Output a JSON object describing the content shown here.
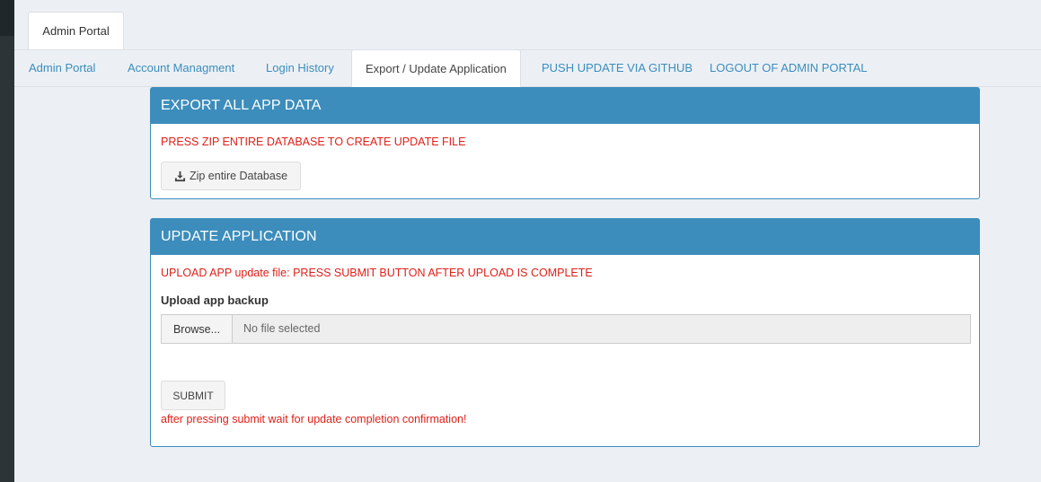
{
  "top_tab": {
    "label": "Admin Portal"
  },
  "nav": {
    "tabs": [
      {
        "label": "Admin Portal"
      },
      {
        "label": "Account Managment"
      },
      {
        "label": "Login History"
      },
      {
        "label": "Export / Update Application"
      },
      {
        "label": "PUSH UPDATE VIA GITHUB"
      },
      {
        "label": "LOGOUT OF ADMIN PORTAL"
      }
    ],
    "active_index": 3
  },
  "export_box": {
    "title": "EXPORT ALL APP DATA",
    "instruction": "PRESS ZIP ENTIRE DATABASE TO CREATE UPDATE FILE",
    "zip_button_label": "Zip entire Database",
    "zip_button_icon": "download-icon"
  },
  "update_box": {
    "title": "UPDATE APPLICATION",
    "instruction": "UPLOAD APP update file: PRESS SUBMIT BUTTON AFTER UPLOAD IS COMPLETE",
    "upload_label": "Upload app backup",
    "browse_label": "Browse...",
    "file_placeholder": "No file selected",
    "submit_label": "SUBMIT",
    "note": "after pressing submit wait for update completion confirmation!"
  },
  "colors": {
    "accent": "#3c8dbc",
    "warning_text": "#e0201a",
    "background": "#ecf0f5"
  }
}
